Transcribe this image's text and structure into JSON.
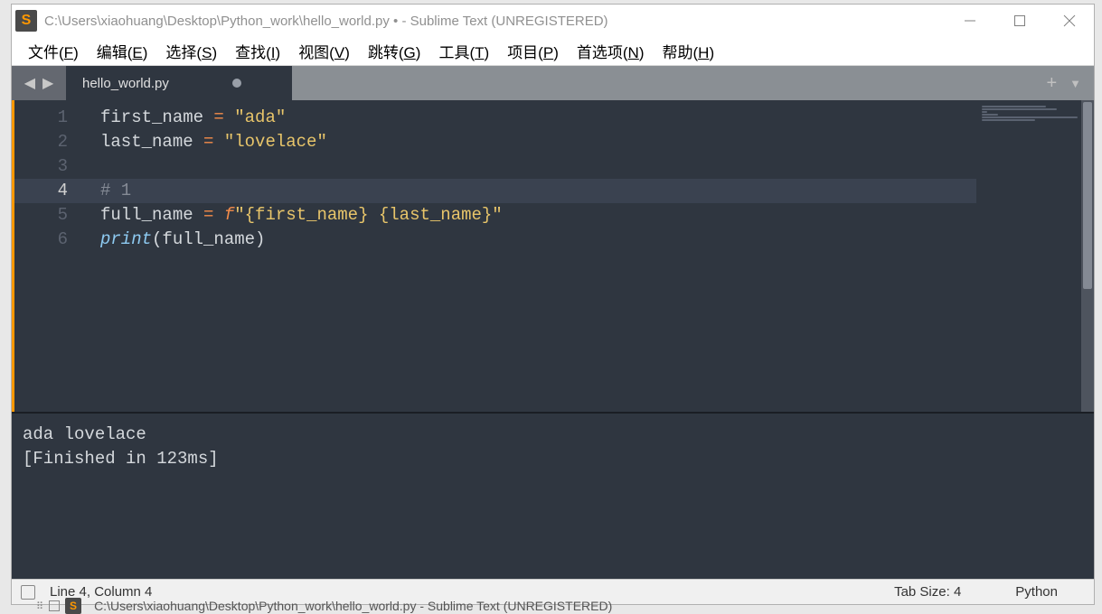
{
  "window": {
    "title": "C:\\Users\\xiaohuang\\Desktop\\Python_work\\hello_world.py • - Sublime Text (UNREGISTERED)",
    "app_icon_letter": "S"
  },
  "menu": {
    "items": [
      {
        "label": "文件",
        "key": "F"
      },
      {
        "label": "编辑",
        "key": "E"
      },
      {
        "label": "选择",
        "key": "S"
      },
      {
        "label": "查找",
        "key": "I"
      },
      {
        "label": "视图",
        "key": "V"
      },
      {
        "label": "跳转",
        "key": "G"
      },
      {
        "label": "工具",
        "key": "T"
      },
      {
        "label": "项目",
        "key": "P"
      },
      {
        "label": "首选项",
        "key": "N"
      },
      {
        "label": "帮助",
        "key": "H"
      }
    ]
  },
  "tabs": {
    "active": {
      "name": "hello_world.py",
      "dirty": true
    }
  },
  "editor": {
    "active_line": 4,
    "lines": [
      {
        "n": 1,
        "tokens": [
          {
            "t": "first_name ",
            "c": ""
          },
          {
            "t": "=",
            "c": "op"
          },
          {
            "t": " ",
            "c": ""
          },
          {
            "t": "\"ada\"",
            "c": "str"
          }
        ]
      },
      {
        "n": 2,
        "tokens": [
          {
            "t": "last_name ",
            "c": ""
          },
          {
            "t": "=",
            "c": "op"
          },
          {
            "t": " ",
            "c": ""
          },
          {
            "t": "\"lovelace\"",
            "c": "str"
          }
        ]
      },
      {
        "n": 3,
        "tokens": []
      },
      {
        "n": 4,
        "tokens": [
          {
            "t": "# 1",
            "c": "com"
          }
        ]
      },
      {
        "n": 5,
        "tokens": [
          {
            "t": "full_name ",
            "c": ""
          },
          {
            "t": "=",
            "c": "op"
          },
          {
            "t": " ",
            "c": ""
          },
          {
            "t": "f",
            "c": "kw"
          },
          {
            "t": "\"{first_name} {last_name}\"",
            "c": "str"
          }
        ]
      },
      {
        "n": 6,
        "tokens": [
          {
            "t": "print",
            "c": "fn"
          },
          {
            "t": "(full_name)",
            "c": ""
          }
        ]
      }
    ]
  },
  "output": {
    "lines": [
      "ada lovelace",
      "[Finished in 123ms]"
    ]
  },
  "status": {
    "position": "Line 4, Column 4",
    "tab_size": "Tab Size: 4",
    "syntax": "Python"
  },
  "taskbar": {
    "text": "C:\\Users\\xiaohuang\\Desktop\\Python_work\\hello_world.py - Sublime Text (UNREGISTERED)"
  }
}
